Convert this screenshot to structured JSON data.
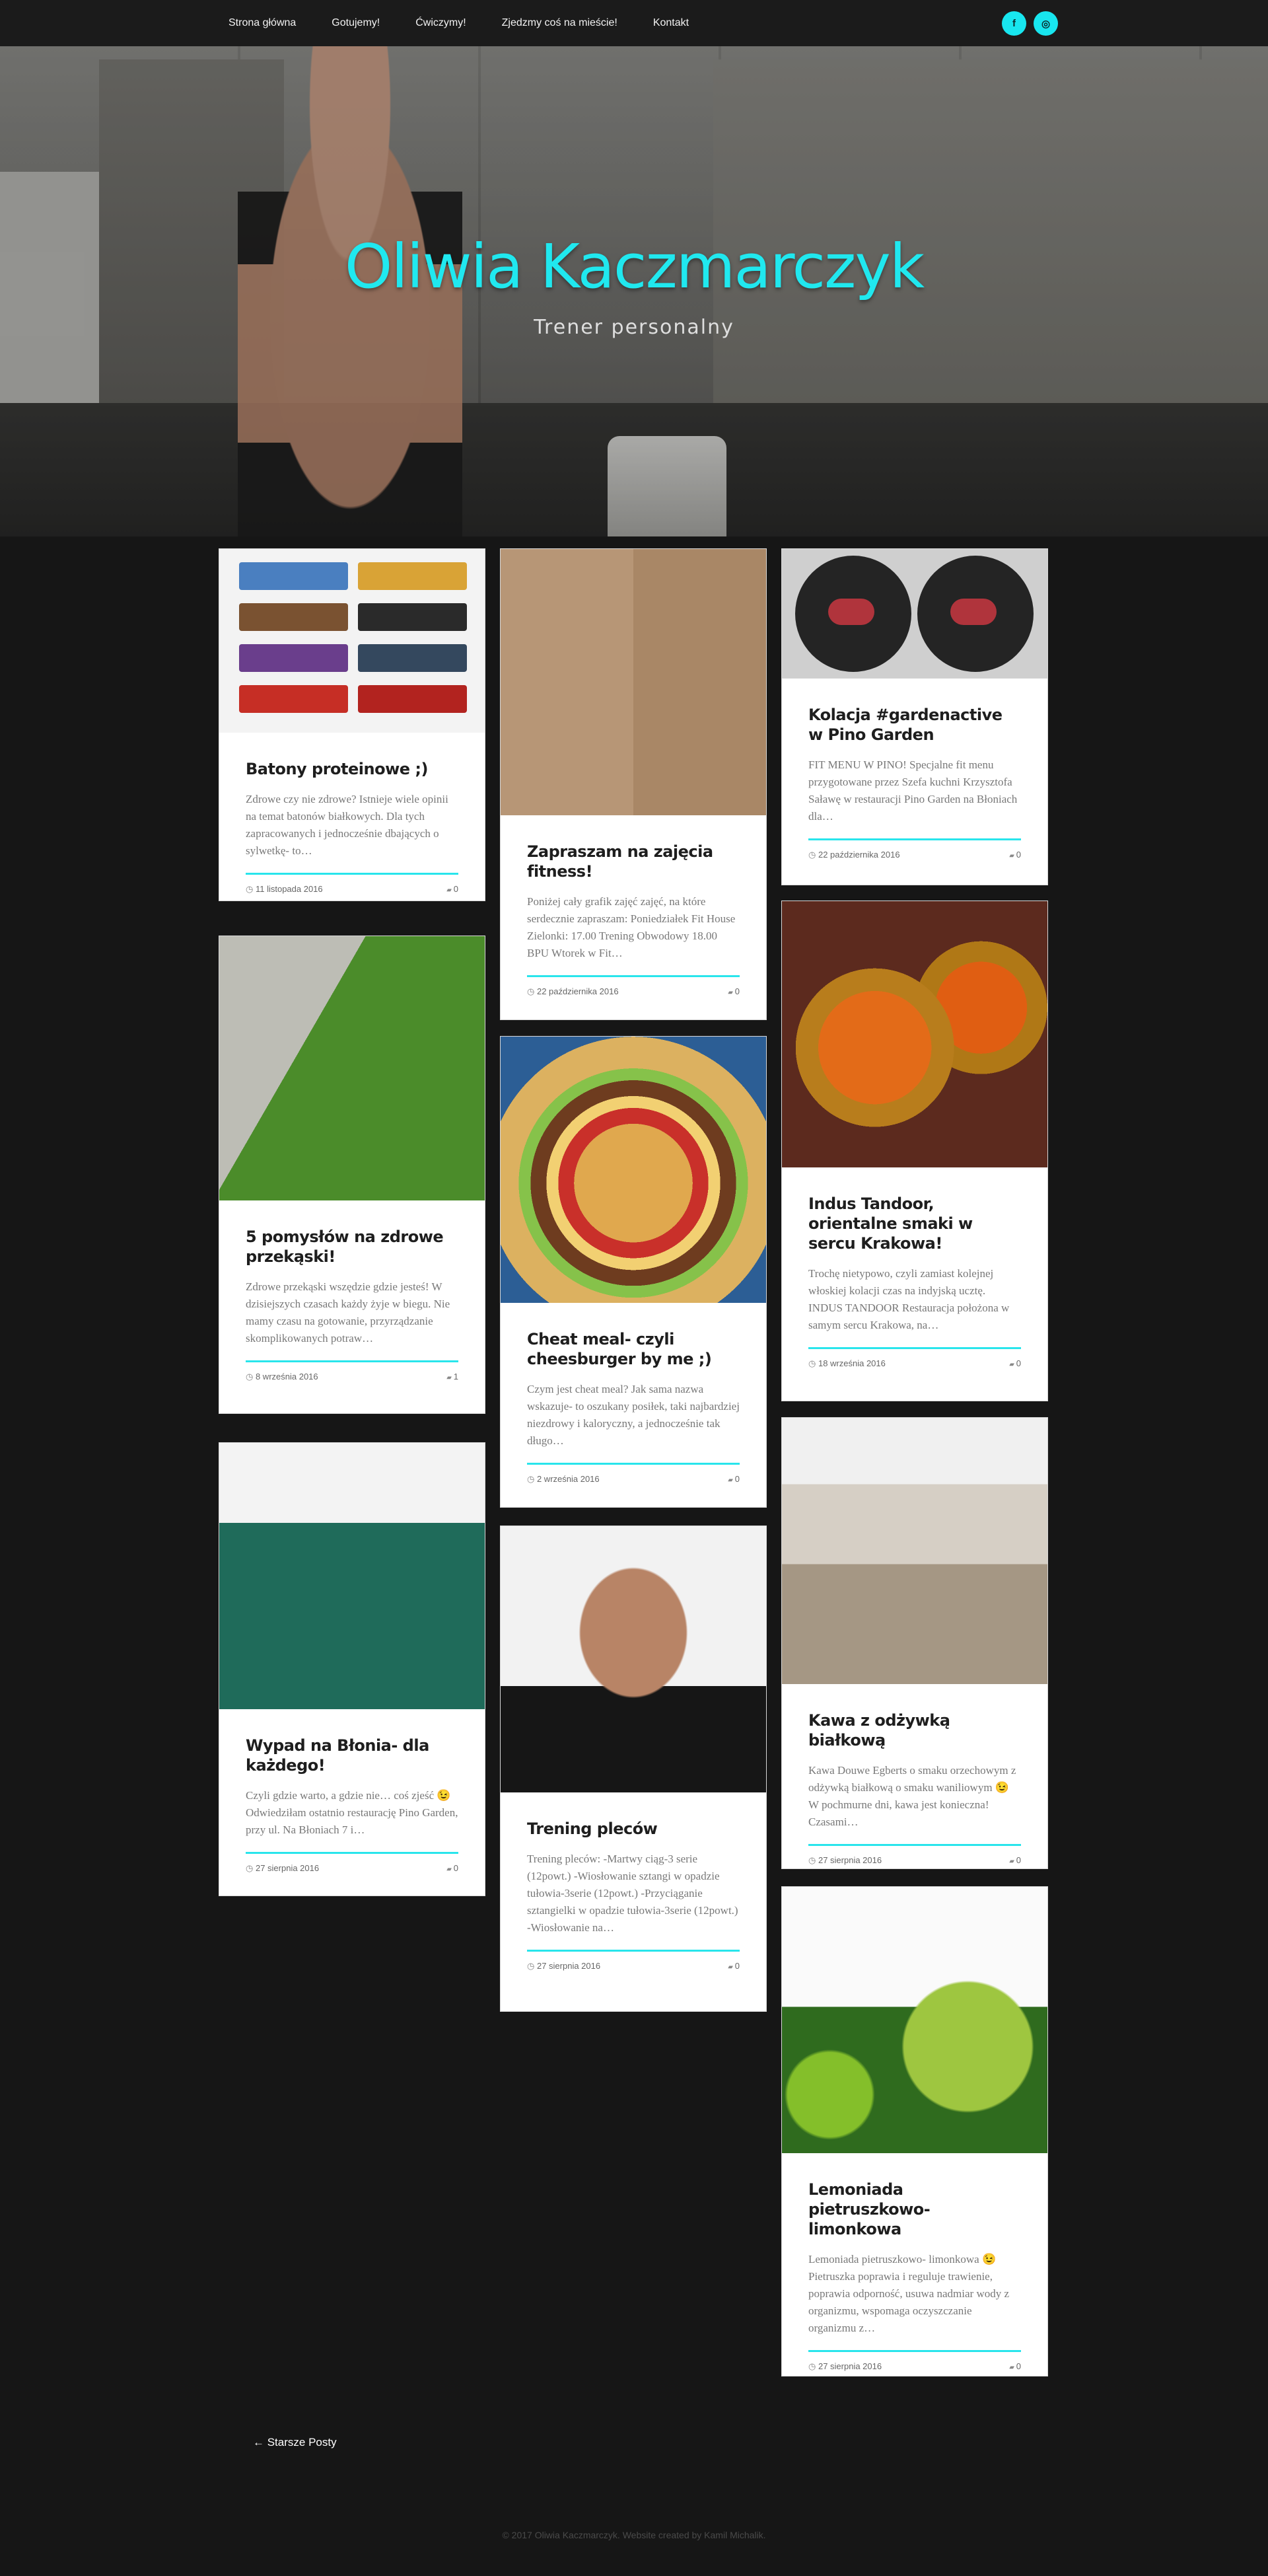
{
  "nav": {
    "items": [
      "Strona główna",
      "Gotujemy!",
      "Ćwiczymy!",
      "Zjedzmy coś na mieście!",
      "Kontakt"
    ],
    "social": [
      {
        "icon": "facebook-icon",
        "glyph": "f"
      },
      {
        "icon": "instagram-icon",
        "glyph": "◎"
      }
    ]
  },
  "hero": {
    "title": "Oliwia Kaczmarczyk",
    "subtitle": "Trener personalny"
  },
  "posts": [
    {
      "title": "Batony proteinowe ;)",
      "excerpt": "Zdrowe czy nie zdrowe? Istnieje wiele opinii na temat batonów białkowych. Dla tych zapracowanych i jednocześnie dbających o sylwetkę- to…",
      "date": "11 listopada 2016",
      "comments": "0",
      "image": "protein-bars"
    },
    {
      "title": "Zapraszam na zajęcia fitness!",
      "excerpt": "Poniżej cały grafik zajęć zajęć, na które serdecznie zapraszam: Poniedziałek Fit House Zielonki: 17.00 Trening Obwodowy 18.00 BPU Wtorek w Fit…",
      "date": "22 października 2016",
      "comments": "0",
      "image": "fitness-mirror"
    },
    {
      "title": "Kolacja #gardenactive w Pino Garden",
      "excerpt": "FIT MENU W PINO! Specjalne fit menu przygotowane przez Szefa kuchni Krzysztofa Saławę w restauracji Pino Garden na Błoniach dla…",
      "date": "22 października 2016",
      "comments": "0",
      "image": "steak-plates"
    },
    {
      "title": "5 pomysłów na zdrowe przekąski!",
      "excerpt": "Zdrowe przekąski wszędzie gdzie jesteś! W dzisiejszych czasach każdy żyje w biegu. Nie mamy czasu na gotowanie, przyrządzanie skomplikowanych potraw…",
      "date": "8 września 2016",
      "comments": "1",
      "image": "snack-walk"
    },
    {
      "title": "Cheat meal- czyli cheesburger by me ;)",
      "excerpt": "Czym jest cheat meal? Jak sama nazwa wskazuje- to oszukany posiłek, taki najbardziej niezdrowy i kaloryczny, a jednocześnie tak długo…",
      "date": "2 września 2016",
      "comments": "0",
      "image": "cheeseburger"
    },
    {
      "title": "Indus Tandoor, orientalne smaki w sercu Krakowa!",
      "excerpt": "Trochę nietypowo, czyli zamiast kolejnej włoskiej kolacji czas na indyjską ucztę. INDUS TANDOOR Restauracja położona w samym sercu Krakowa, na…",
      "date": "18 września 2016",
      "comments": "0",
      "image": "indian-dishes"
    },
    {
      "title": "Wypad na Błonia- dla każdego!",
      "excerpt": "Czyli gdzie warto, a gdzie nie… coś zjeść 😉 Odwiedziłam ostatnio restaurację Pino Garden, przy ul. Na Błoniach 7 i…",
      "date": "27 sierpnia 2016",
      "comments": "0",
      "image": "pino-can"
    },
    {
      "title": "Trening pleców",
      "excerpt": "Trening pleców: -Martwy ciąg-3 serie (12powt.) -Wiosłowanie sztangi w opadzie tułowia-3serie (12powt.) -Przyciąganie sztangielki w opadzie tułowia-3serie (12powt.) -Wiosłowanie na…",
      "date": "27 sierpnia 2016",
      "comments": "0",
      "image": "back-workout"
    },
    {
      "title": "Kawa z odżywką białkową",
      "excerpt": "Kawa Douwe Egberts o smaku orzechowym z odżywką białkową o smaku waniliowym 😉 W pochmurne dni, kawa jest konieczna! Czasami…",
      "date": "27 sierpnia 2016",
      "comments": "0",
      "image": "iced-coffee"
    },
    {
      "title": "Lemoniada pietruszkowo-limonkowa",
      "excerpt": "Lemoniada pietruszkowo- limonkowa 😉 Pietruszka poprawia i reguluje trawienie, poprawia odporność, usuwa nadmiar wody z organizmu, wspomaga oczyszczanie organizmu z…",
      "date": "27 sierpnia 2016",
      "comments": "0",
      "image": "green-lemonade"
    }
  ],
  "pagination": {
    "older": "← Starsze Posty"
  },
  "footer": {
    "text": "© 2017 Oliwia Kaczmarczyk. Website created by Kamil Michalik."
  },
  "colors": {
    "accent": "#20e8ef",
    "background": "#161616",
    "nav": "#1b1b1b"
  }
}
